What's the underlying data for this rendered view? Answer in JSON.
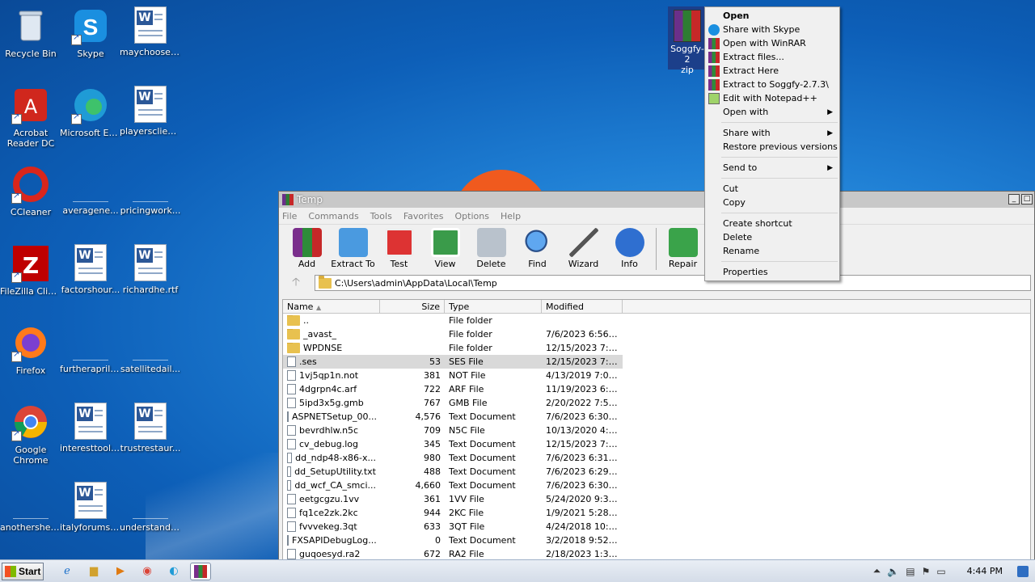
{
  "desktop": {
    "icons": [
      {
        "label": "Recycle Bin"
      },
      {
        "label": "Skype"
      },
      {
        "label": "maychoose.rtf"
      },
      {
        "label": "Acrobat Reader DC"
      },
      {
        "label": "Microsoft Edge"
      },
      {
        "label": "playersclien..."
      },
      {
        "label": "CCleaner"
      },
      {
        "label": "averagene..."
      },
      {
        "label": "pricingwork..."
      },
      {
        "label": "FileZilla Client"
      },
      {
        "label": "factorshour..."
      },
      {
        "label": "richardhe.rtf"
      },
      {
        "label": "Firefox"
      },
      {
        "label": "furtherapril...."
      },
      {
        "label": "satellitedail..."
      },
      {
        "label": "Google Chrome"
      },
      {
        "label": "interesttool.rtf"
      },
      {
        "label": "trustrestaur..."
      },
      {
        "label": "anothershe...."
      },
      {
        "label": "italyforums.rtf"
      },
      {
        "label": "understand...."
      }
    ],
    "zip_icon": {
      "line1": "Soggfy-2",
      "line2": "zip"
    }
  },
  "context_menu": {
    "items": [
      {
        "label": "Open",
        "bold": true
      },
      {
        "label": "Share with Skype",
        "icon": "skype-icon"
      },
      {
        "label": "Open with WinRAR",
        "icon": "winrar-icon"
      },
      {
        "label": "Extract files...",
        "icon": "winrar-icon"
      },
      {
        "label": "Extract Here",
        "icon": "winrar-icon"
      },
      {
        "label": "Extract to Soggfy-2.7.3\\",
        "icon": "winrar-icon"
      },
      {
        "label": "Edit with Notepad++",
        "icon": "notepad-icon"
      },
      {
        "label": "Open with",
        "submenu": true
      },
      {
        "separator": true
      },
      {
        "label": "Share with",
        "submenu": true
      },
      {
        "label": "Restore previous versions"
      },
      {
        "separator": true
      },
      {
        "label": "Send to",
        "submenu": true
      },
      {
        "separator": true
      },
      {
        "label": "Cut"
      },
      {
        "label": "Copy"
      },
      {
        "separator": true
      },
      {
        "label": "Create shortcut"
      },
      {
        "label": "Delete"
      },
      {
        "label": "Rename"
      },
      {
        "separator": true
      },
      {
        "label": "Properties"
      }
    ]
  },
  "winrar": {
    "title": "Temp",
    "menu": [
      "File",
      "Commands",
      "Tools",
      "Favorites",
      "Options",
      "Help"
    ],
    "toolbar": [
      "Add",
      "Extract To",
      "Test",
      "View",
      "Delete",
      "Find",
      "Wizard",
      "Info",
      "Repair"
    ],
    "address": "C:\\Users\\admin\\AppData\\Local\\Temp",
    "columns": {
      "name": "Name",
      "size": "Size",
      "type": "Type",
      "modified": "Modified"
    },
    "files": [
      {
        "name": "..",
        "size": "",
        "type": "File folder",
        "modified": "",
        "folder": true
      },
      {
        "name": "_avast_",
        "size": "",
        "type": "File folder",
        "modified": "7/6/2023 6:56 PM",
        "folder": true
      },
      {
        "name": "WPDNSE",
        "size": "",
        "type": "File folder",
        "modified": "12/15/2023 7:5...",
        "folder": true
      },
      {
        "name": ".ses",
        "size": "53",
        "type": "SES File",
        "modified": "12/15/2023 7:5...",
        "selected": true
      },
      {
        "name": "1vj5qp1n.not",
        "size": "381",
        "type": "NOT File",
        "modified": "4/13/2019 7:05..."
      },
      {
        "name": "4dgrpn4c.arf",
        "size": "722",
        "type": "ARF File",
        "modified": "11/19/2023 6:2..."
      },
      {
        "name": "5ipd3x5g.gmb",
        "size": "767",
        "type": "GMB File",
        "modified": "2/20/2022 7:57..."
      },
      {
        "name": "ASPNETSetup_00...",
        "size": "4,576",
        "type": "Text Document",
        "modified": "7/6/2023 6:30 PM"
      },
      {
        "name": "bevrdhlw.n5c",
        "size": "709",
        "type": "N5C File",
        "modified": "10/13/2020 4:3..."
      },
      {
        "name": "cv_debug.log",
        "size": "345",
        "type": "Text Document",
        "modified": "12/15/2023 7:5..."
      },
      {
        "name": "dd_ndp48-x86-x...",
        "size": "980",
        "type": "Text Document",
        "modified": "7/6/2023 6:31 PM"
      },
      {
        "name": "dd_SetupUtility.txt",
        "size": "488",
        "type": "Text Document",
        "modified": "7/6/2023 6:29 PM"
      },
      {
        "name": "dd_wcf_CA_smci...",
        "size": "4,660",
        "type": "Text Document",
        "modified": "7/6/2023 6:30 PM"
      },
      {
        "name": "eetgcgzu.1vv",
        "size": "361",
        "type": "1VV File",
        "modified": "5/24/2020 9:34..."
      },
      {
        "name": "fq1ce2zk.2kc",
        "size": "944",
        "type": "2KC File",
        "modified": "1/9/2021 5:28 PM"
      },
      {
        "name": "fvvvekeg.3qt",
        "size": "633",
        "type": "3QT File",
        "modified": "4/24/2018 10:4..."
      },
      {
        "name": "FXSAPIDebugLog...",
        "size": "0",
        "type": "Text Document",
        "modified": "3/2/2018 9:52 AM"
      },
      {
        "name": "guqoesyd.ra2",
        "size": "672",
        "type": "RA2 File",
        "modified": "2/18/2023 1:35..."
      }
    ]
  },
  "taskbar": {
    "start_label": "Start",
    "clock": "4:44 PM"
  },
  "watermark": "ANY RUN",
  "colors": {
    "desktop_bg": "#1f7fd4",
    "selection": "#d9d9d9",
    "menu_bg": "#f0f0f0"
  }
}
